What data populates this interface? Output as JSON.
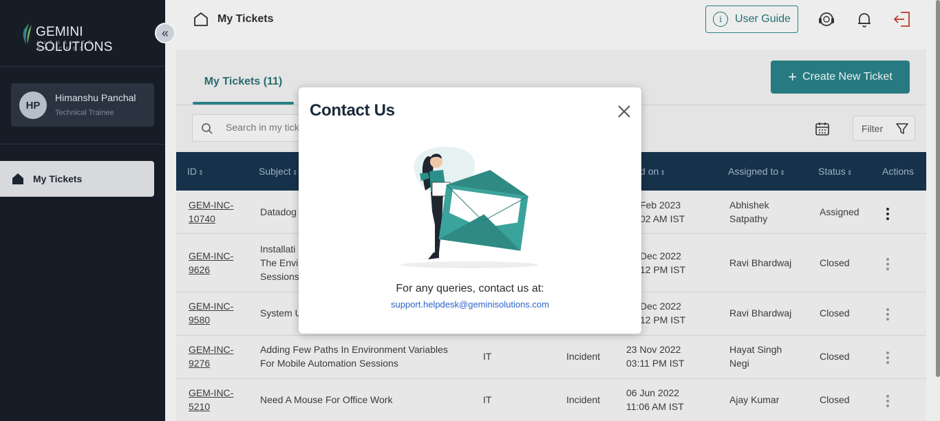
{
  "sidebar": {
    "logo_main": "GEMINI SOLUTIONS",
    "logo_main_a": "GEMINI",
    "logo_main_b": "SOLUTIONS",
    "logo_tagline": "VISUALIZE SUCCESS",
    "collapse_glyph": "«",
    "profile": {
      "initials": "HP",
      "name": "Himanshu Panchal",
      "role": "Technical Trainee"
    },
    "nav": [
      {
        "label": "My Tickets",
        "icon": "home-icon",
        "active": true
      }
    ]
  },
  "topbar": {
    "title": "My Tickets",
    "user_guide": "User Guide",
    "icons": [
      "help-support-icon",
      "bell-icon",
      "logout-icon"
    ]
  },
  "main": {
    "tab": "My Tickets (11)",
    "create_button": "Create New Ticket",
    "search_placeholder": "Search in my tickets",
    "filter_label": "Filter",
    "columns": [
      "ID",
      "Subject",
      "Created on",
      "Assigned to",
      "Status",
      "Actions"
    ],
    "rows": [
      {
        "id_a": "GEM-INC-",
        "id_b": "10740",
        "subject_a": "Datadog",
        "subject_b": "",
        "subject_c": "",
        "category": "",
        "type": "",
        "created_a": "Feb 2023",
        "created_b": "02 AM IST",
        "assigned_a": "Abhishek",
        "assigned_b": "Satpathy",
        "status": "Assigned"
      },
      {
        "id_a": "GEM-INC-",
        "id_b": "9626",
        "subject_a": "Installati",
        "subject_b": "The Envir",
        "subject_c": "Sessions.",
        "category": "",
        "type": "",
        "created_a": "Dec 2022",
        "created_b": "12 PM IST",
        "assigned_a": "Ravi Bhardwaj",
        "assigned_b": "",
        "status": "Closed"
      },
      {
        "id_a": "GEM-INC-",
        "id_b": "9580",
        "subject_a": "System U",
        "subject_b": "",
        "subject_c": "",
        "category": "",
        "type": "",
        "created_a": "Dec 2022",
        "created_b": "12 PM IST",
        "assigned_a": "Ravi Bhardwaj",
        "assigned_b": "",
        "status": "Closed"
      },
      {
        "id_a": "GEM-INC-",
        "id_b": "9276",
        "subject_a": "Adding Few Paths In Environment Variables",
        "subject_b": "For Mobile Automation Sessions",
        "subject_c": "",
        "category": "IT",
        "type": "Incident",
        "created_a": "23 Nov 2022",
        "created_b": "03:11 PM IST",
        "assigned_a": "Hayat Singh",
        "assigned_b": "Negi",
        "status": "Closed"
      },
      {
        "id_a": "GEM-INC-",
        "id_b": "5210",
        "subject_a": "Need A Mouse For Office Work",
        "subject_b": "",
        "subject_c": "",
        "category": "IT",
        "type": "Incident",
        "created_a": "06 Jun 2022",
        "created_b": "11:06 AM IST",
        "assigned_a": "Ajay Kumar",
        "assigned_b": "",
        "status": "Closed"
      }
    ]
  },
  "modal": {
    "title": "Contact Us",
    "text": "For any queries, contact us at:",
    "email": "support.helpdesk@geminisolutions.com"
  },
  "colors": {
    "teal": "#277a80",
    "navy": "#16324b",
    "sidebar": "#161d27"
  }
}
